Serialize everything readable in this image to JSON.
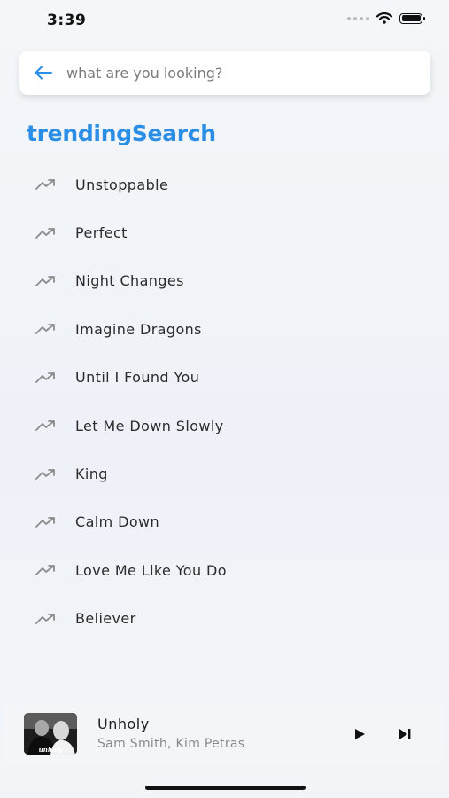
{
  "status_bar": {
    "time": "3:39"
  },
  "search": {
    "placeholder": "what are you looking?",
    "value": ""
  },
  "trending": {
    "title": "trendingSearch",
    "items": [
      {
        "label": "Unstoppable",
        "icon": "trending-up-icon"
      },
      {
        "label": "Perfect",
        "icon": "trending-up-icon"
      },
      {
        "label": "Night Changes",
        "icon": "trending-up-icon"
      },
      {
        "label": "Imagine Dragons",
        "icon": "trending-up-icon"
      },
      {
        "label": "Until I Found You",
        "icon": "trending-up-icon"
      },
      {
        "label": "Let Me Down Slowly",
        "icon": "trending-up-icon"
      },
      {
        "label": "King",
        "icon": "trending-up-icon"
      },
      {
        "label": "Calm Down",
        "icon": "trending-up-icon"
      },
      {
        "label": "Love Me Like You Do",
        "icon": "trending-up-icon"
      },
      {
        "label": "Believer",
        "icon": "trending-up-icon"
      }
    ]
  },
  "player": {
    "title": "Unholy",
    "artist": "Sam Smith, Kim Petras",
    "album_art_text": "unholy"
  },
  "colors": {
    "accent": "#2a8ee6",
    "icon_gray": "#8c8c8c",
    "text": "#2b2b2b",
    "subtext": "#8a8a8a"
  }
}
